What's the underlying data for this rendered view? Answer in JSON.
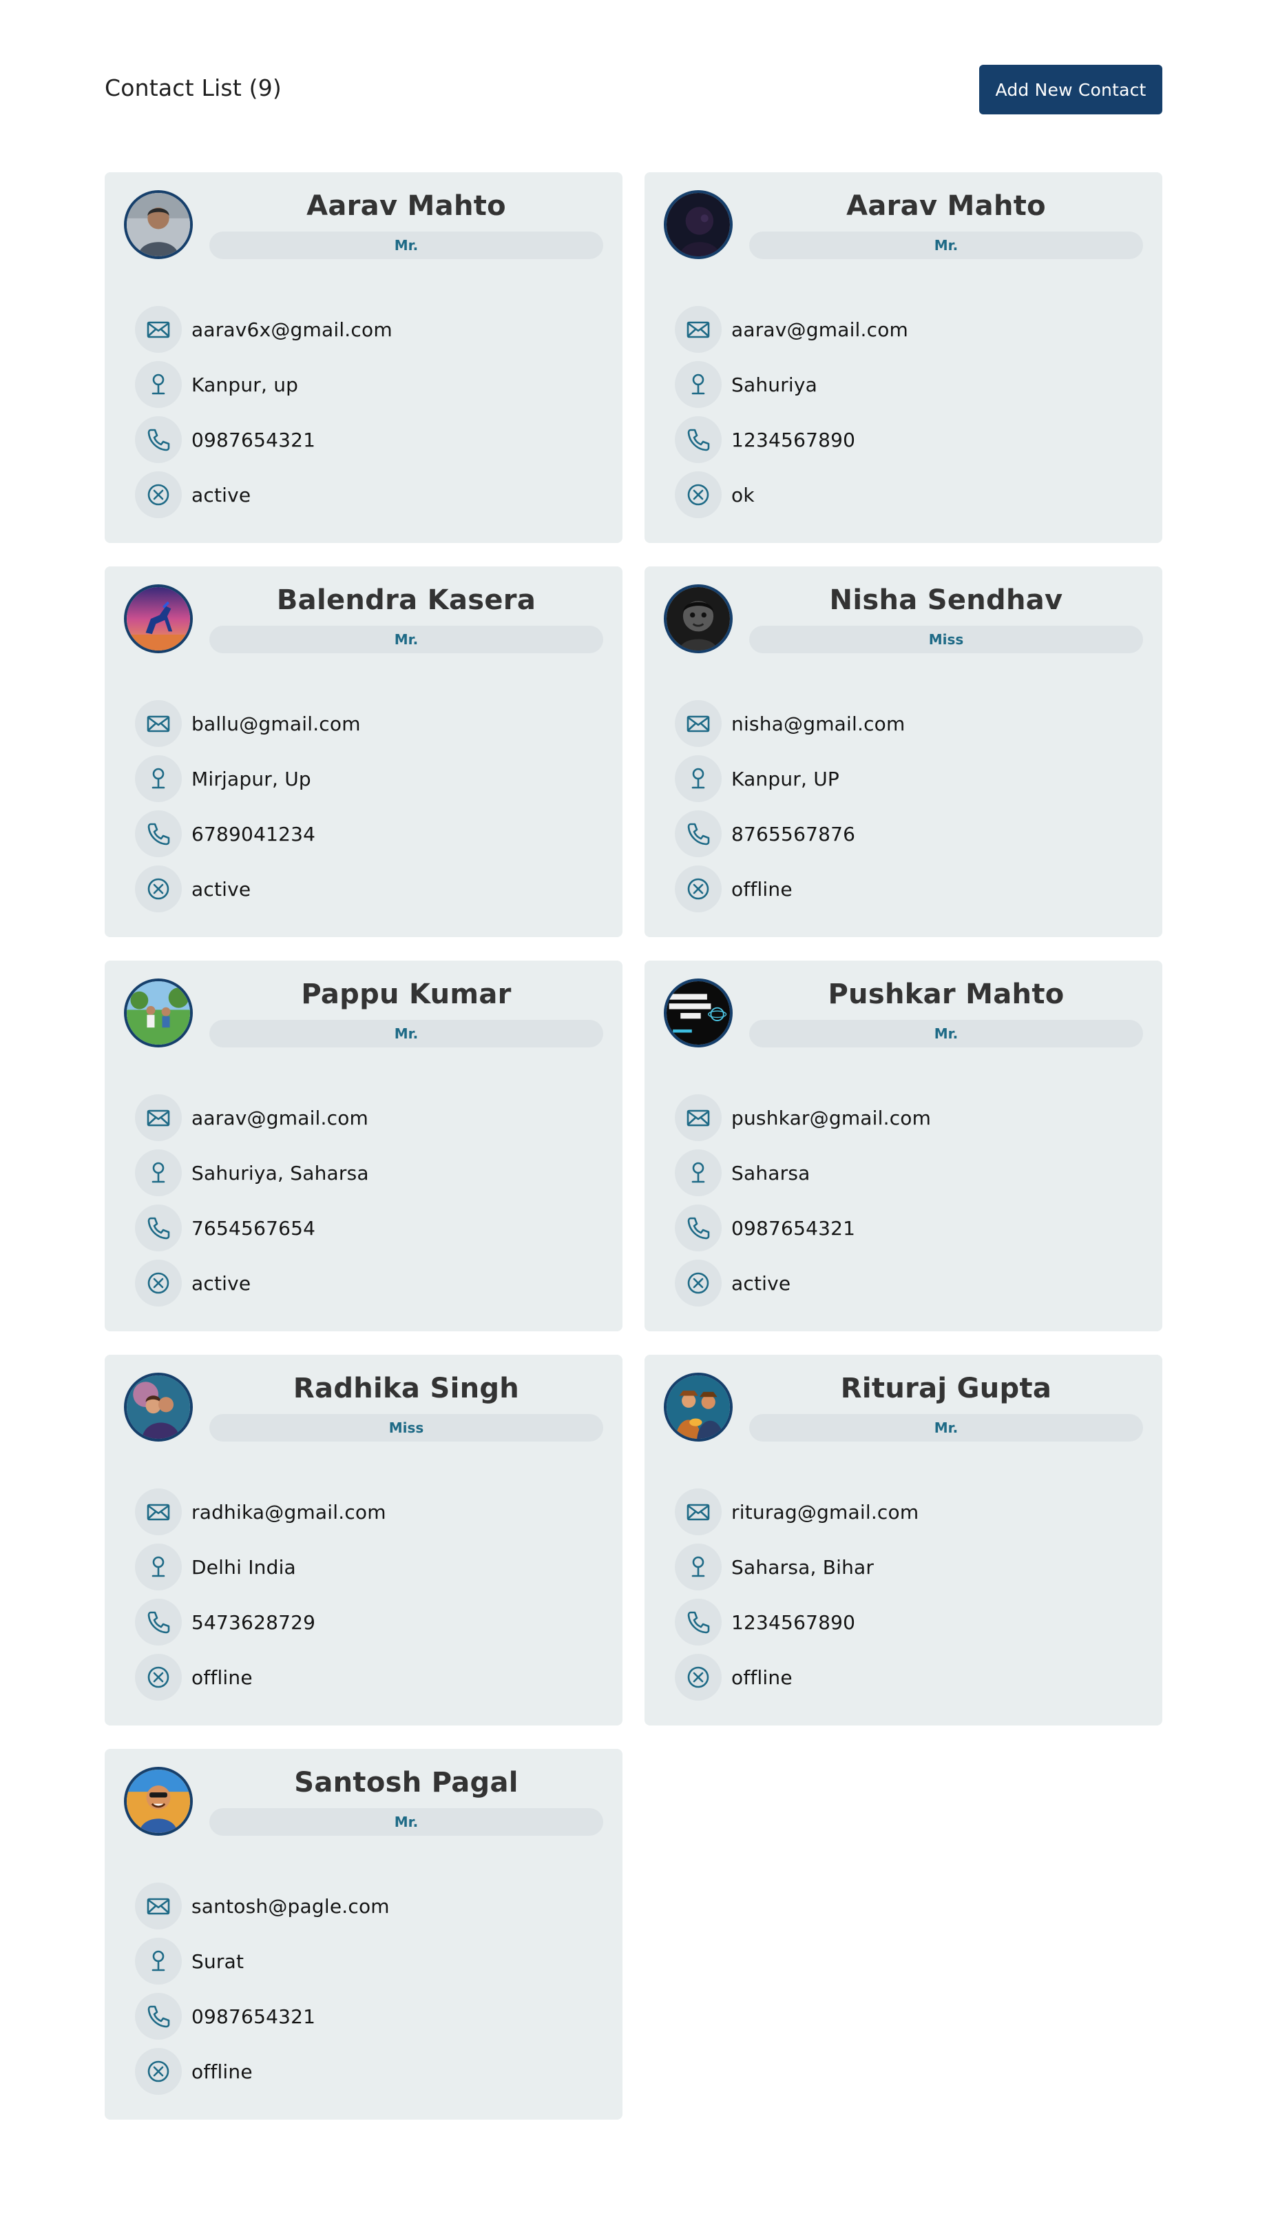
{
  "header": {
    "title": "Contact List (9)",
    "add_button_label": "Add New Contact"
  },
  "colors": {
    "accent": "#163f6b",
    "card_bg": "#e9eeef",
    "pill_bg": "#dde3e6",
    "pill_text": "#1e6a86",
    "icon_stroke": "#1e6a86"
  },
  "contacts": [
    {
      "name": "Aarav Mahto",
      "title": "Mr.",
      "email": "aarav6x@gmail.com",
      "address": "Kanpur, up",
      "phone": "0987654321",
      "status": "active",
      "avatar": "man-portrait-photo"
    },
    {
      "name": "Aarav Mahto",
      "title": "Mr.",
      "email": "aarav@gmail.com",
      "address": "Sahuriya",
      "phone": "1234567890",
      "status": "ok",
      "avatar": "dark-portrait-photo"
    },
    {
      "name": "Balendra Kasera",
      "title": "Mr.",
      "email": "ballu@gmail.com",
      "address": "Mirjapur, Up",
      "phone": "6789041234",
      "status": "active",
      "avatar": "horse-sunset-photo"
    },
    {
      "name": "Nisha Sendhav",
      "title": "Miss",
      "email": "nisha@gmail.com",
      "address": "Kanpur, UP",
      "phone": "8765567876",
      "status": "offline",
      "avatar": "child-bw-photo"
    },
    {
      "name": "Pappu Kumar",
      "title": "Mr.",
      "email": "aarav@gmail.com",
      "address": "Sahuriya, Saharsa",
      "phone": "7654567654",
      "status": "active",
      "avatar": "friends-outdoor-photo"
    },
    {
      "name": "Pushkar Mahto",
      "title": "Mr.",
      "email": "pushkar@gmail.com",
      "address": "Saharsa",
      "phone": "0987654321",
      "status": "active",
      "avatar": "landing-page-thumbnail"
    },
    {
      "name": "Radhika Singh",
      "title": "Miss",
      "email": "radhika@gmail.com",
      "address": "Delhi India",
      "phone": "5473628729",
      "status": "offline",
      "avatar": "couple-illustration"
    },
    {
      "name": "Rituraj Gupta",
      "title": "Mr.",
      "email": "riturag@gmail.com",
      "address": "Saharsa, Bihar",
      "phone": "1234567890",
      "status": "offline",
      "avatar": "musicians-illustration"
    },
    {
      "name": "Santosh Pagal",
      "title": "Mr.",
      "email": "santosh@pagle.com",
      "address": "Surat",
      "phone": "0987654321",
      "status": "offline",
      "avatar": "cartoon-man-photo"
    }
  ]
}
